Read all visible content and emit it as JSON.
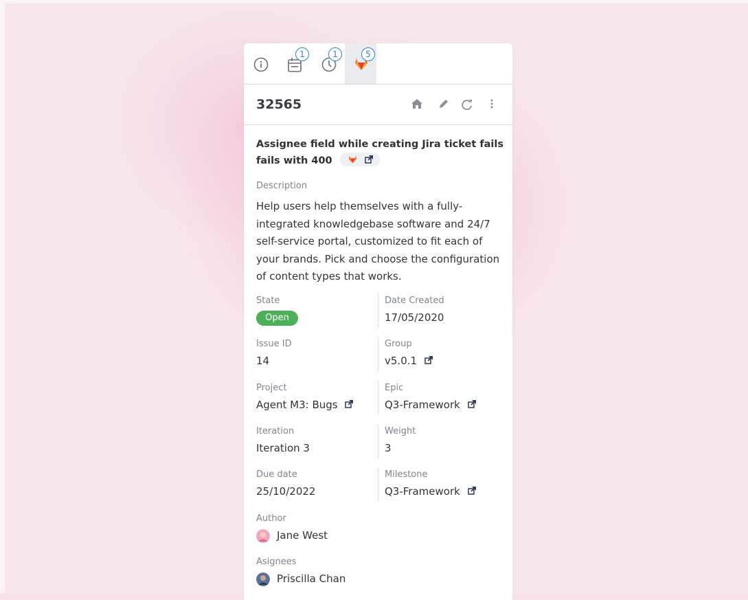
{
  "tabs": [
    {
      "name": "info",
      "badge": ""
    },
    {
      "name": "calendar",
      "badge": "1"
    },
    {
      "name": "clock",
      "badge": "1"
    },
    {
      "name": "gitlab",
      "badge": "5"
    }
  ],
  "header": {
    "ticket_id": "32565"
  },
  "issue": {
    "title": "Assignee field while creating  Jira ticket fails fails with 400",
    "description_label": "Description",
    "description": "Help users help themselves with a fully-integrated knowledgebase software and 24/7 self-service portal, customized to fit each of your brands. Pick and choose the configuration of content types that works."
  },
  "fields": {
    "state_label": "State",
    "state_value": "Open",
    "date_created_label": "Date Created",
    "date_created_value": "17/05/2020",
    "issue_id_label": "Issue ID",
    "issue_id_value": "14",
    "group_label": "Group",
    "group_value": "v5.0.1",
    "project_label": "Project",
    "project_value": "Agent M3: Bugs",
    "epic_label": "Epic",
    "epic_value": "Q3-Framework",
    "iteration_label": "Iteration",
    "iteration_value": "Iteration 3",
    "weight_label": "Weight",
    "weight_value": "3",
    "due_date_label": "Due date",
    "due_date_value": "25/10/2022",
    "milestone_label": "Milestone",
    "milestone_value": "Q3-Framework",
    "author_label": "Author",
    "author_value": "Jane West",
    "assignees_label": "Asignees",
    "assignees_value": "Priscilla Chan"
  },
  "colors": {
    "accent": "#2f7fd6",
    "status_open": "#4caf59",
    "gitlab_orange": "#e24329"
  }
}
